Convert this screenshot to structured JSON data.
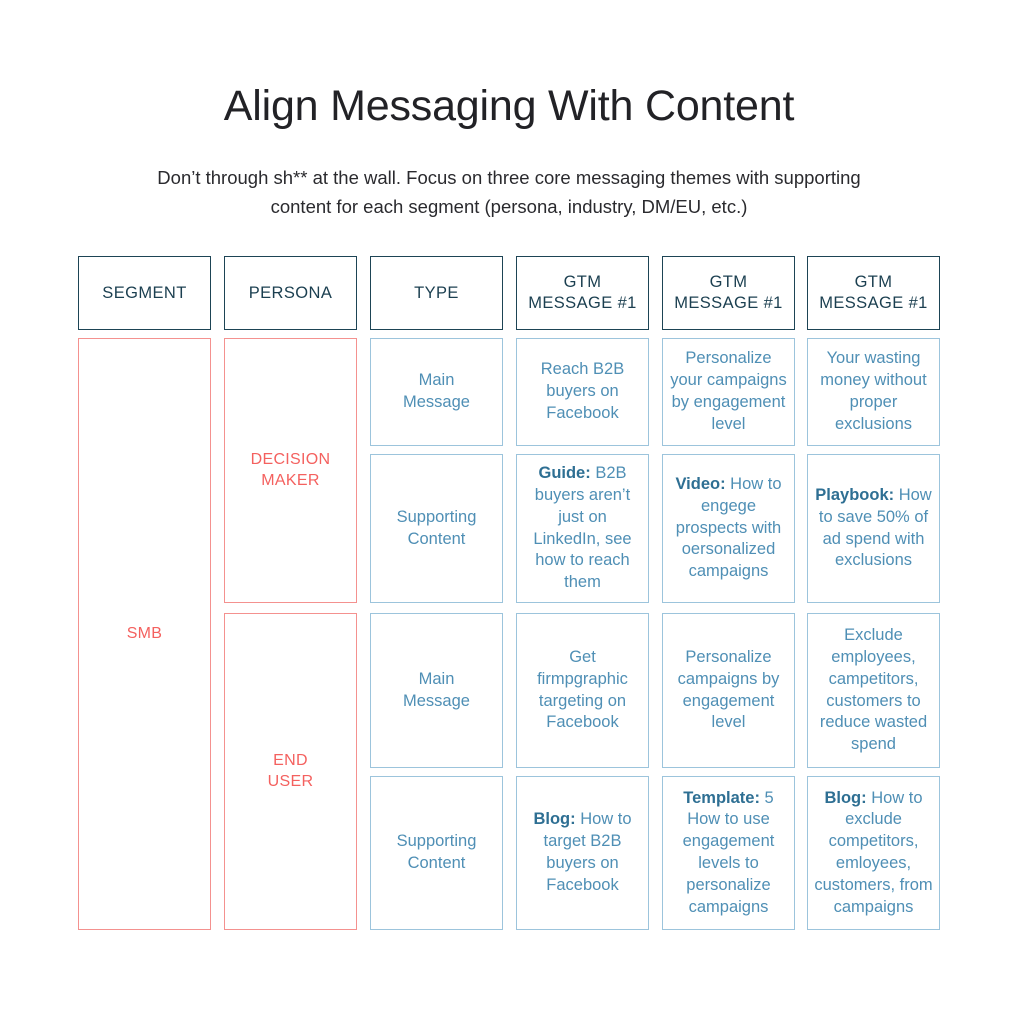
{
  "slide": {
    "title": "Align Messaging With Content",
    "subtitle": "Don’t through sh** at the wall. Focus on three core messaging themes with supporting content for each segment (persona, industry, DM/EU, etc.)"
  },
  "colors": {
    "title_text": "#222226",
    "header_border": "#1d4455",
    "header_text": "#1b3f50",
    "red_border": "#f4918f",
    "red_text": "#f4615f",
    "blue_border": "#9cc4dc",
    "blue_text": "#4f8fb5",
    "blue_lead_text": "#2e6f93",
    "background": "#ffffff"
  },
  "table": {
    "headers": [
      "SEGMENT",
      "PERSONA",
      "TYPE",
      "GTM\nMESSAGE #1",
      "GTM\nMESSAGE #1",
      "GTM\nMESSAGE #1"
    ],
    "segment": "SMB",
    "personas": [
      "DECISION\nMAKER",
      "END\nUSER"
    ],
    "types": [
      "Main\nMessage",
      "Supporting\nContent",
      "Main\nMessage",
      "Supporting\nContent"
    ],
    "rows": [
      {
        "type": "Main\nMessage",
        "messages": [
          {
            "lead": "",
            "body": "Reach B2B buyers on Facebook"
          },
          {
            "lead": "",
            "body": "Personalize your campaigns by engagement level"
          },
          {
            "lead": "",
            "body": "Your wasting money without proper exclusions"
          }
        ]
      },
      {
        "type": "Supporting\nContent",
        "messages": [
          {
            "lead": "Guide:",
            "body": " B2B buyers aren’t just on LinkedIn, see how to reach them"
          },
          {
            "lead": "Video:",
            "body": " How to engege prospects with oersonalized campaigns"
          },
          {
            "lead": "Playbook:",
            "body": " How to save 50% of ad spend with exclusions"
          }
        ]
      },
      {
        "type": "Main\nMessage",
        "messages": [
          {
            "lead": "",
            "body": "Get firmpgraphic targeting on Facebook"
          },
          {
            "lead": "",
            "body": "Personalize campaigns by engagement level"
          },
          {
            "lead": "",
            "body": "Exclude employees, campetitors, customers to reduce wasted spend"
          }
        ]
      },
      {
        "type": "Supporting\nContent",
        "messages": [
          {
            "lead": "Blog:",
            "body": " How to target B2B buyers on Facebook"
          },
          {
            "lead": "Template:",
            "body": " 5 How to use engagement levels to personalize campaigns"
          },
          {
            "lead": "Blog:",
            "body": " How to exclude competitors, emloyees, customers, from campaigns"
          }
        ]
      }
    ]
  }
}
